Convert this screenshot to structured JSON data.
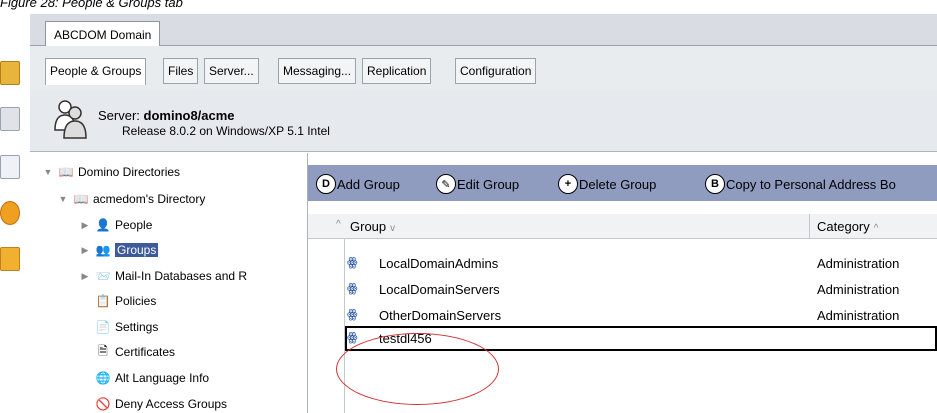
{
  "caption": "Figure 28: People & Groups tab",
  "domain_tab": "ABCDOM Domain",
  "subtabs": [
    "People & Groups",
    "Files",
    "Server...",
    "Messaging...",
    "Replication",
    "Configuration"
  ],
  "server": {
    "prefix": "Server: ",
    "name": "domino8/acme",
    "release": "Release 8.0.2 on Windows/XP 5.1 Intel"
  },
  "tree": {
    "root": "Domino Directories",
    "directory": "acmedom's Directory",
    "people": "People",
    "groups": "Groups",
    "mailin": "Mail-In Databases and R",
    "policies": "Policies",
    "settings": "Settings",
    "certificates": "Certificates",
    "altlang": "Alt Language Info",
    "deny": "Deny Access Groups"
  },
  "actions": {
    "add_group": "Add Group",
    "edit_group": "Edit Group",
    "delete_group": "Delete Group",
    "copy": "Copy to Personal Address Bo"
  },
  "columns": {
    "group": "Group",
    "category": "Category"
  },
  "rows": [
    {
      "name": "LocalDomainAdmins",
      "category": "Administration"
    },
    {
      "name": "LocalDomainServers",
      "category": "Administration"
    },
    {
      "name": "OtherDomainServers",
      "category": "Administration"
    },
    {
      "name": "testdl456",
      "category": ""
    }
  ],
  "colors": {
    "action_bar": "#8f9cbf",
    "selection": "#3d5a9a",
    "annotation": "#d23030"
  }
}
